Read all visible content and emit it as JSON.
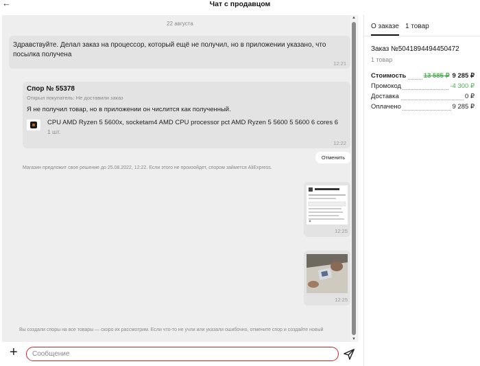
{
  "header": {
    "back_icon": "arrow-left-icon",
    "title": "Чат с продавцом"
  },
  "chat": {
    "date": "22 августа",
    "message1": {
      "text": "Здравствуйте. Делал заказ на процессор, который ещё не получил, но в приложении указано, что посылка получена",
      "time": "12:21"
    },
    "dispute": {
      "title": "Спор № 55378",
      "reason": "Открыл покупатель: Не доставили заказ",
      "text": "Я не получил товар, но в приложении он числится как полученный.",
      "product_name": "CPU AMD Ryzen 5 5600x, socketam4 AMD CPU processor pct AMD Ryzen 5 5600 5 5600 6 cores 6",
      "product_qty": "1 шт.",
      "time": "12:22"
    },
    "cancel_button": "Отменить",
    "store_note": "Магазин предложит свое решение до 25.08.2022, 12:22. Если этого не произойдет, спором займется AliExpress.",
    "image_messages": [
      {
        "time": "12:25"
      },
      {
        "time": "12:25"
      }
    ],
    "footer_note": "Вы создали споры на все товары — скоро их рассмотрим. Если что-то не учли или указали ошибочно, отмените спор и создайте новый"
  },
  "composer": {
    "placeholder": "Сообщение",
    "plus_icon": "plus-icon",
    "send_icon": "send-icon"
  },
  "panel": {
    "tabs": [
      "О заказе",
      "1 товар"
    ],
    "order_title": "Заказ №5041894494450472",
    "order_count": "1 товар",
    "summary": {
      "cost_label": "Стоимость",
      "cost_old": "13 585 ₽",
      "cost_value": "9 285 ₽",
      "promo_label": "Промокод",
      "promo_value": "-4 300 ₽",
      "delivery_label": "Доставка",
      "delivery_value": "0 ₽",
      "paid_label": "Оплачено",
      "paid_value": "9 285 ₽"
    }
  },
  "colors": {
    "accent_red": "#c62828",
    "discount_green": "#4caf50",
    "bubble": "#e3e3e3",
    "chat_bg": "#eeeeee"
  }
}
